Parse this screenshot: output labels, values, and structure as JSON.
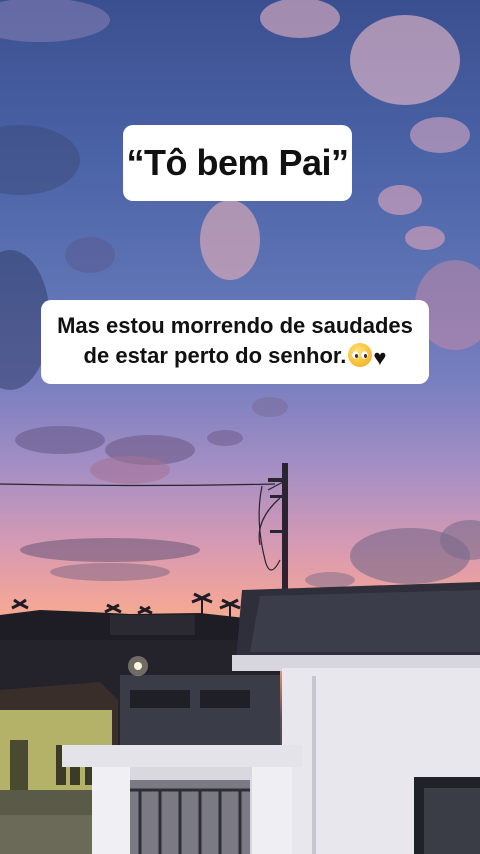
{
  "captions": {
    "top": "“Tô bem Pai”",
    "bottom_line1": "Mas estou morrendo de saudades",
    "bottom_line2": "de estar perto do senhor."
  },
  "emojis": [
    "pleading-face",
    "black-heart"
  ],
  "colors": {
    "caption_bg": "#ffffff",
    "caption_text": "#111111",
    "sky_top": "#3a4f8f",
    "sunset_glow": "#f6b08a"
  }
}
